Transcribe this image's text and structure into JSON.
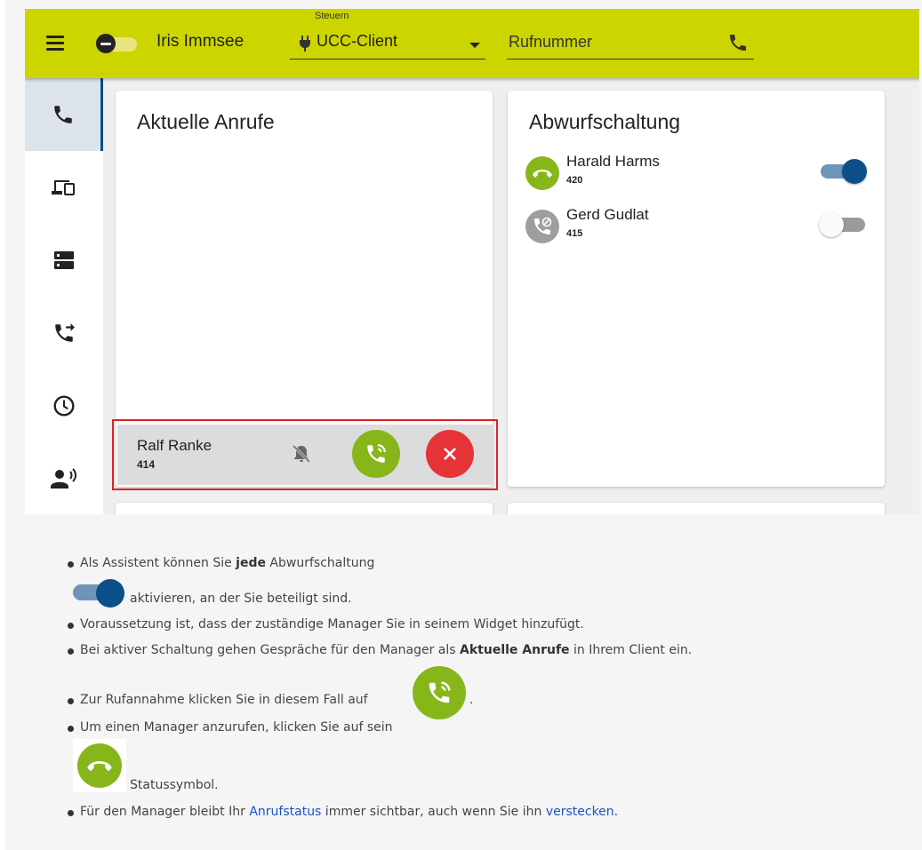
{
  "topbar": {
    "user_name": "Iris Immsee",
    "control_label": "Steuern",
    "control_value": "UCC-Client",
    "phone_placeholder": "Rufnummer",
    "accent_color": "#ccd500"
  },
  "sidebar": {
    "items": [
      {
        "icon": "phone-icon",
        "active": true
      },
      {
        "icon": "devices-icon",
        "active": false
      },
      {
        "icon": "server-icon",
        "active": false
      },
      {
        "icon": "call-forward-icon",
        "active": false
      },
      {
        "icon": "clock-icon",
        "active": false
      },
      {
        "icon": "voice-icon",
        "active": false
      }
    ],
    "active_color": "#0a4f86"
  },
  "current_calls": {
    "title": "Aktuelle Anrufe",
    "call": {
      "name": "Ralf Ranke",
      "number": "414"
    }
  },
  "divert": {
    "title": "Abwurfschaltung",
    "managers": [
      {
        "name": "Harald Harms",
        "number": "420",
        "status": "available",
        "enabled": true
      },
      {
        "name": "Gerd Gudlat",
        "number": "415",
        "status": "busy",
        "enabled": false
      }
    ]
  },
  "notes": {
    "b1_pre": "Als Assistent können Sie ",
    "b1_bold": "jede",
    "b1_post": " Abwurfschaltung",
    "b1_cont": "aktivieren, an der Sie beteiligt sind.",
    "b2": "Voraussetzung ist, dass der zuständige Manager Sie in seinem Widget hinzufügt.",
    "b3_pre": "Bei aktiver Schaltung gehen Gespräche für den Manager als ",
    "b3_bold": "Aktuelle Anrufe",
    "b3_post": " in Ihrem Client ein.",
    "b4_pre": "Zur Rufannahme klicken Sie in diesem Fall auf ",
    "b4_post": ".",
    "b5_pre": "Um einen Manager anzurufen, klicken Sie auf sein",
    "b5_cont": "Statussymbol.",
    "b6_pre": "Für den Manager bleibt Ihr ",
    "b6_link1": "Anrufstatus",
    "b6_mid": " immer sichtbar, auch wenn Sie ihn ",
    "b6_link2": "verstecken",
    "b6_post": "."
  }
}
